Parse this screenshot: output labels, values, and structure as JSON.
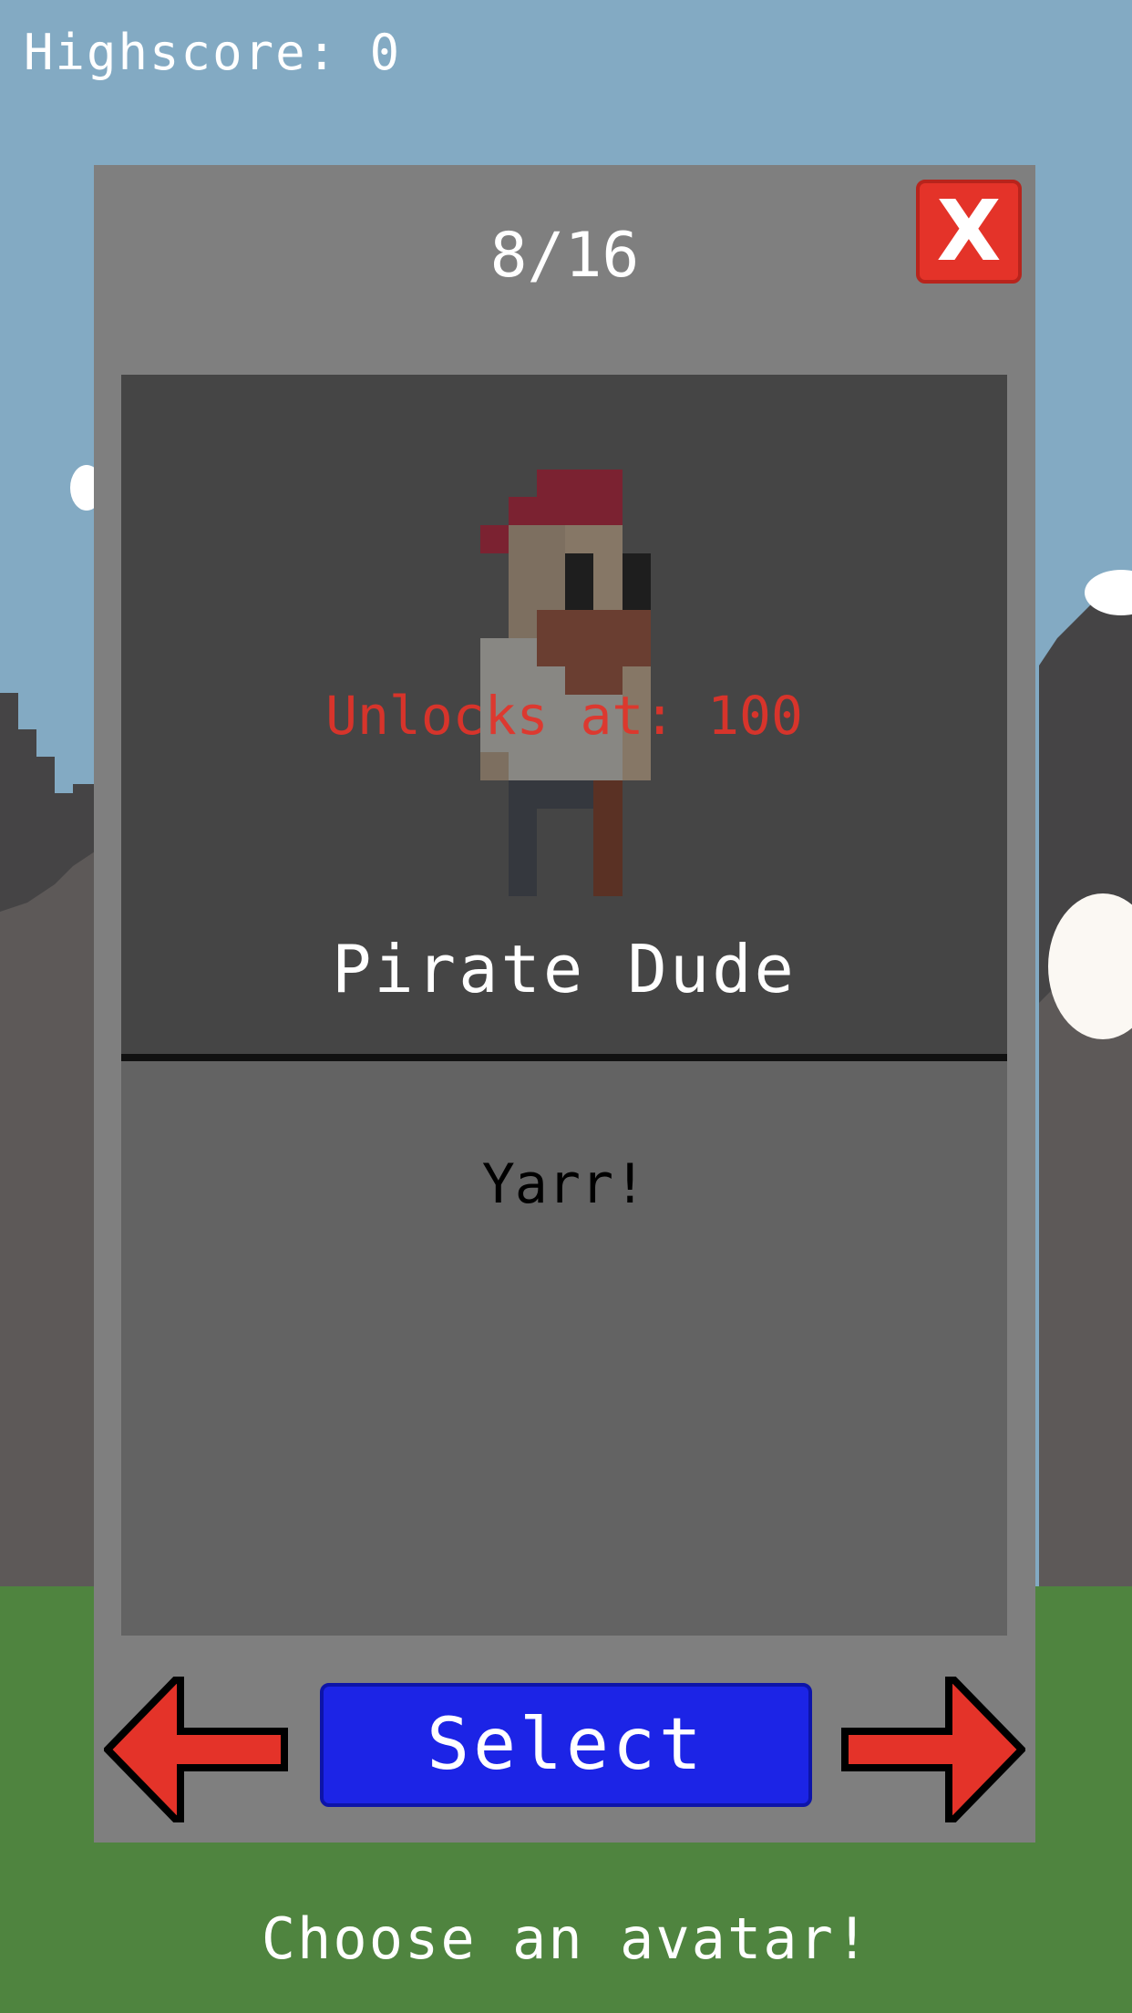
{
  "hud": {
    "highscore": "Highscore: 0"
  },
  "avatar_picker": {
    "counter": "8/16",
    "close_label": "X",
    "avatar_name": "Pirate Dude",
    "unlock_text": "Unlocks at: 100",
    "description": "Yarr!",
    "select_label": "Select"
  },
  "footer": {
    "prompt": "Choose an avatar!"
  },
  "icons": {
    "close": "close-icon",
    "left": "arrow-left-icon",
    "right": "arrow-right-icon"
  },
  "colors": {
    "sky": "#83aac3",
    "grass": "#4f843f",
    "panel": "#7f7f7f",
    "preview_bg": "#454545",
    "description_bg": "#636363",
    "close_red": "#e43329",
    "select_blue": "#1c24e6",
    "unlock_red": "#e43329"
  }
}
